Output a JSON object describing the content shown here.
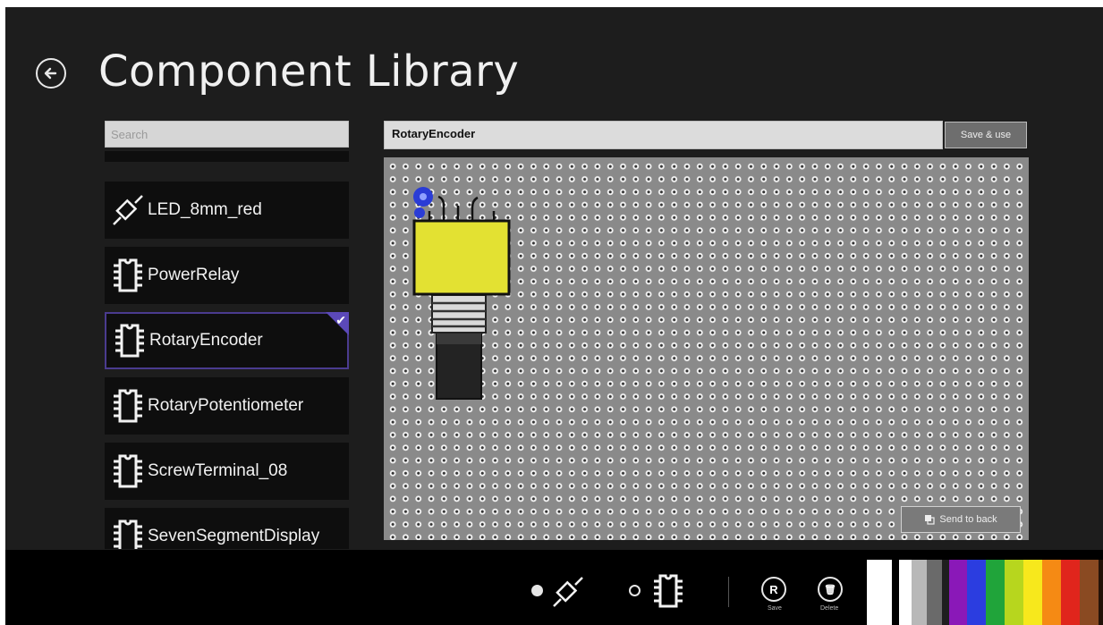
{
  "header": {
    "title": "Component Library"
  },
  "search": {
    "placeholder": "Search"
  },
  "components": [
    {
      "label": "LED_8mm_red",
      "icon": "led-icon",
      "selected": false
    },
    {
      "label": "PowerRelay",
      "icon": "chip-icon",
      "selected": false
    },
    {
      "label": "RotaryEncoder",
      "icon": "chip-icon",
      "selected": true
    },
    {
      "label": "RotaryPotentiometer",
      "icon": "chip-icon",
      "selected": false
    },
    {
      "label": "ScrewTerminal_08",
      "icon": "chip-icon",
      "selected": false
    },
    {
      "label": "SevenSegmentDisplay",
      "icon": "chip-icon",
      "selected": false
    }
  ],
  "editor": {
    "component_name": "RotaryEncoder",
    "save_use_label": "Save & use",
    "send_back_label": "Send to back"
  },
  "toolbar": {
    "save_label": "Save",
    "delete_label": "Delete",
    "save_glyph": "R",
    "delete_glyph": "🗑"
  },
  "colors": {
    "selection_accent": "#5b49b8",
    "board": "#8a8a8a",
    "component_body": "#e3e132",
    "pin_marker": "#2a3cd6"
  },
  "palette": [
    "#ffffff",
    "#000000",
    "#ffffff",
    "#b8b8b8",
    "#6a6a6a",
    "#1e1e1e",
    "#8a18b8",
    "#2b3de0",
    "#20a43a",
    "#b7d61e",
    "#f7e81c",
    "#f58a14",
    "#e0251c",
    "#8a4a22",
    "#231208"
  ]
}
